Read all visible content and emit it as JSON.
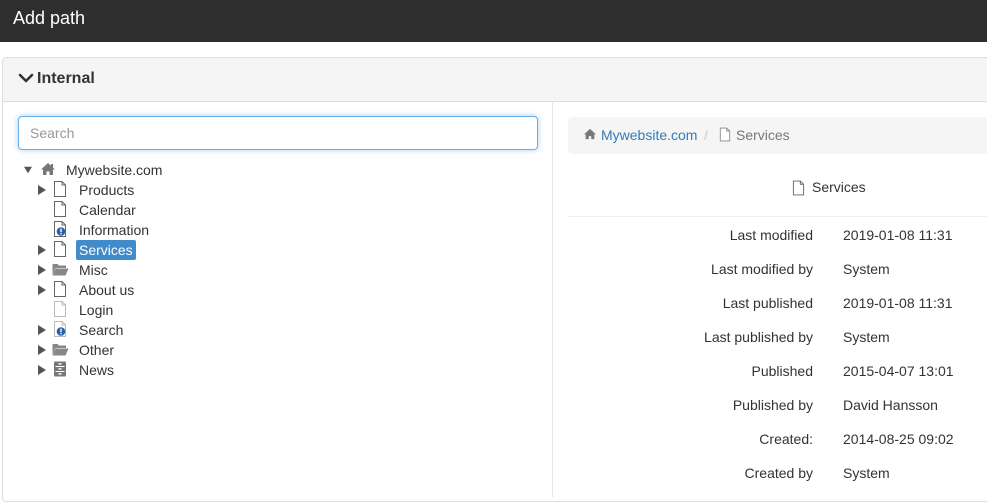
{
  "header": {
    "title": "Add path"
  },
  "panel": {
    "heading": "Internal"
  },
  "search": {
    "placeholder": "Search",
    "value": ""
  },
  "tree": {
    "root": {
      "label": "Mywebsite.com",
      "icon": "home-icon",
      "expanded": true
    },
    "items": [
      {
        "label": "Products",
        "icon": "page-icon",
        "has_children": true,
        "selected": false
      },
      {
        "label": "Calendar",
        "icon": "page-icon",
        "has_children": false,
        "selected": false
      },
      {
        "label": "Information",
        "icon": "page-warning-icon",
        "has_children": false,
        "selected": false
      },
      {
        "label": "Services",
        "icon": "page-icon",
        "has_children": true,
        "selected": true
      },
      {
        "label": "Misc",
        "icon": "folder-icon",
        "has_children": true,
        "selected": false
      },
      {
        "label": "About us",
        "icon": "page-icon",
        "has_children": true,
        "selected": false
      },
      {
        "label": "Login",
        "icon": "page-icon",
        "has_children": false,
        "selected": false
      },
      {
        "label": "Search",
        "icon": "page-warning-icon",
        "has_children": true,
        "selected": false
      },
      {
        "label": "Other",
        "icon": "folder-icon",
        "has_children": true,
        "selected": false
      },
      {
        "label": "News",
        "icon": "archive-icon",
        "has_children": true,
        "selected": false
      }
    ]
  },
  "breadcrumb": {
    "site": "Mywebsite.com",
    "separator": "/",
    "current": "Services"
  },
  "details": {
    "title": "Services",
    "properties": [
      {
        "key": "Last modified",
        "value": "2019-01-08 11:31"
      },
      {
        "key": "Last modified by",
        "value": "System"
      },
      {
        "key": "Last published",
        "value": "2019-01-08 11:31"
      },
      {
        "key": "Last published by",
        "value": "System"
      },
      {
        "key": "Published",
        "value": "2015-04-07 13:01"
      },
      {
        "key": "Published by",
        "value": "David Hansson"
      },
      {
        "key": "Created:",
        "value": "2014-08-25 09:02"
      },
      {
        "key": "Created by",
        "value": "System"
      }
    ]
  },
  "colors": {
    "topbar": "#2e2e2e",
    "link": "#337ab7",
    "selection": "#428bca",
    "warning_badge": "#2a5fa8"
  }
}
